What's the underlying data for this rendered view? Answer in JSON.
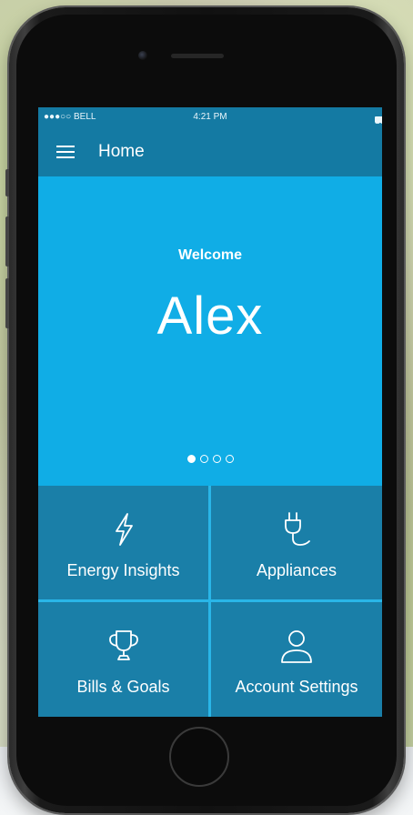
{
  "status_bar": {
    "carrier": "●●●○○ BELL",
    "time": "4:21 PM",
    "battery": "100%"
  },
  "nav": {
    "title": "Home"
  },
  "hero": {
    "welcome": "Welcome",
    "name": "Alex",
    "pages": 4,
    "active_page": 1
  },
  "tiles": [
    {
      "label": "Energy Insights",
      "icon": "lightning-icon"
    },
    {
      "label": "Appliances",
      "icon": "plug-icon"
    },
    {
      "label": "Bills & Goals",
      "icon": "trophy-icon"
    },
    {
      "label": "Account Settings",
      "icon": "user-icon"
    }
  ],
  "colors": {
    "hero": "#10ade6",
    "nav": "#147aa3",
    "tile": "#1a7fa8",
    "divider": "#29b6e8"
  }
}
